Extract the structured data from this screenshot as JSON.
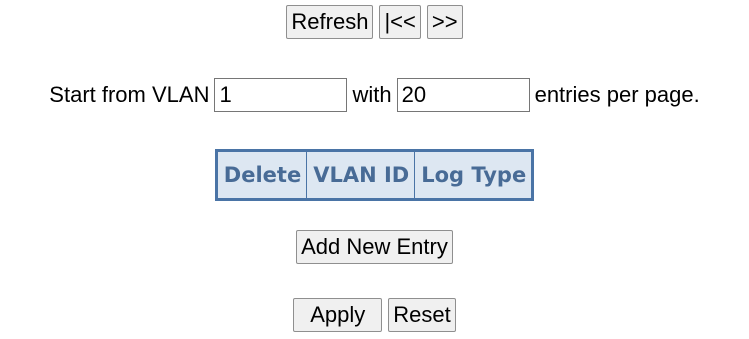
{
  "navigation": {
    "refresh_label": "Refresh",
    "first_label": "|<<",
    "next_label": ">>"
  },
  "paging": {
    "start_label": "Start from VLAN",
    "start_value": "1",
    "with_label": "with",
    "entries_value": "20",
    "suffix_label": "entries per page."
  },
  "table": {
    "columns": [
      "Delete",
      "VLAN ID",
      "Log Type"
    ],
    "rows": []
  },
  "actions": {
    "add_label": "Add New Entry",
    "apply_label": "Apply",
    "reset_label": "Reset"
  },
  "colors": {
    "table_border": "#4a74a6",
    "header_background": "#dde7f2",
    "header_text": "#486b96"
  }
}
